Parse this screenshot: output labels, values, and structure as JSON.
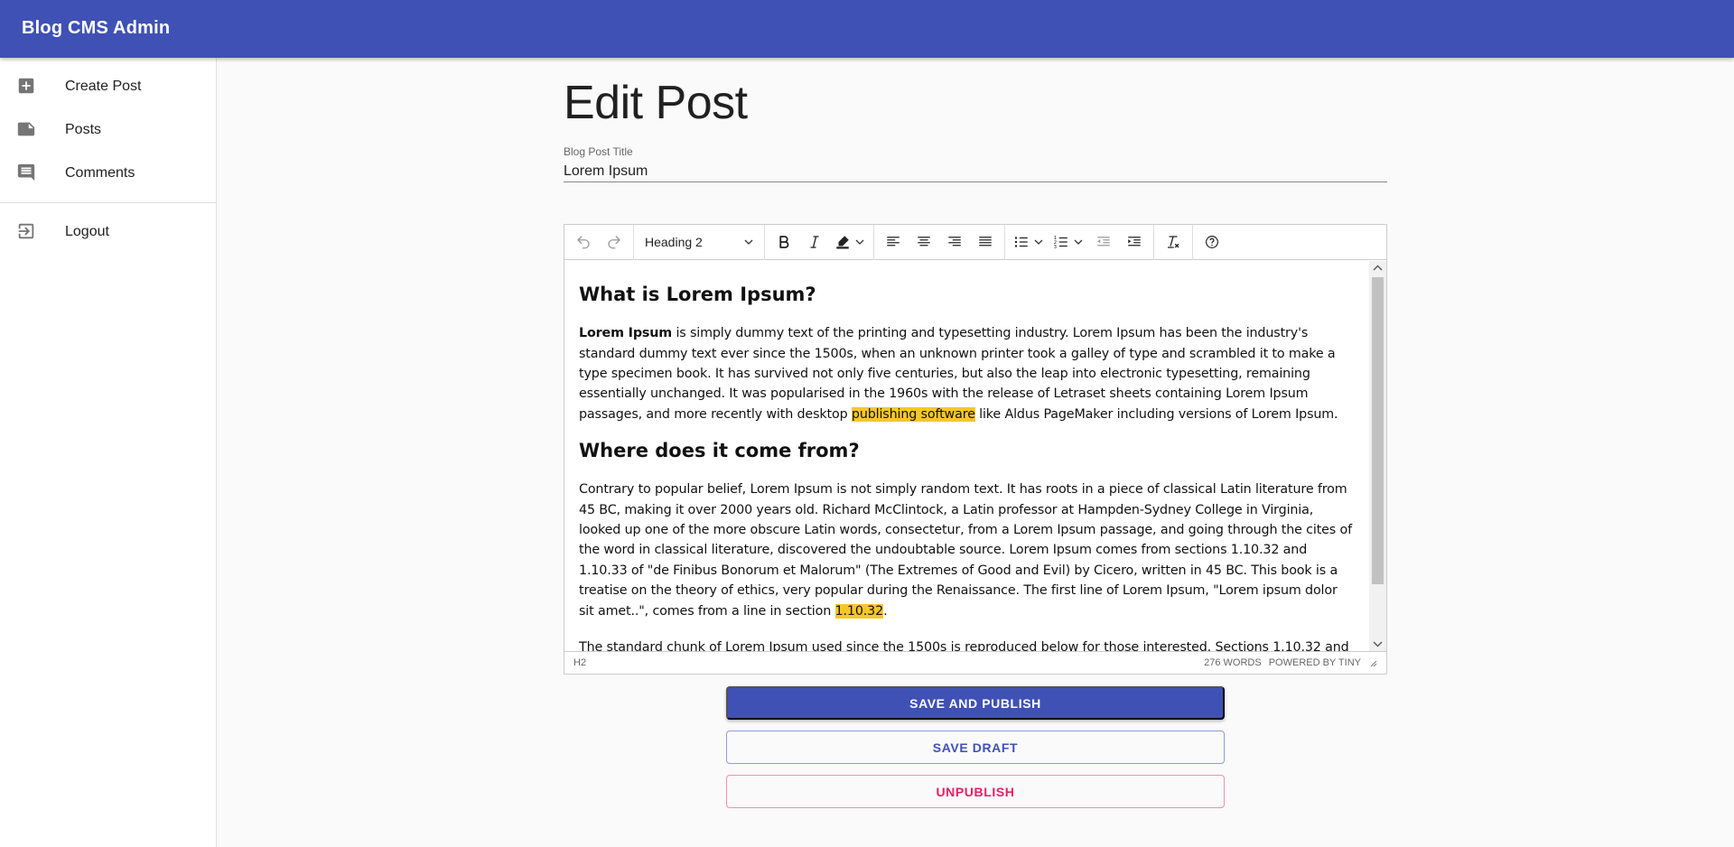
{
  "app": {
    "title": "Blog CMS Admin"
  },
  "nav": {
    "items": [
      {
        "label": "Create Post",
        "icon": "add-box-icon"
      },
      {
        "label": "Posts",
        "icon": "note-icon"
      },
      {
        "label": "Comments",
        "icon": "comment-icon"
      }
    ],
    "logout": {
      "label": "Logout",
      "icon": "logout-icon"
    }
  },
  "page": {
    "title": "Edit Post",
    "title_field": {
      "label": "Blog Post Title",
      "value": "Lorem Ipsum"
    }
  },
  "editor": {
    "toolbar": {
      "block_format": "Heading 2",
      "buttons": [
        "undo",
        "redo",
        "bold",
        "italic",
        "highlight-color",
        "align-left",
        "align-center",
        "align-right",
        "justify",
        "bullet-list",
        "numbered-list",
        "outdent",
        "indent",
        "clear-formatting",
        "help"
      ]
    },
    "content": {
      "h1": "What is Lorem Ipsum?",
      "p1": {
        "bold": "Lorem Ipsum",
        "text": " is simply dummy text of the printing and typesetting industry. Lorem Ipsum has been the industry's standard dummy text ever since the 1500s, when an unknown printer took a galley of type and scrambled it to make a type specimen book. It has survived not only five centuries, but also the leap into electronic typesetting, remaining essentially unchanged. It was popularised in the 1960s with the release of Letraset sheets containing Lorem Ipsum passages, and more recently with desktop ",
        "highlight": "publishing software",
        "tail": " like Aldus PageMaker including versions of Lorem Ipsum."
      },
      "h2": "Where does it come from?",
      "p2": {
        "text": "Contrary to popular belief, Lorem Ipsum is not simply random text. It has roots in a piece of classical Latin literature from 45 BC, making it over 2000 years old. Richard McClintock, a Latin professor at Hampden-Sydney College in Virginia, looked up one of the more obscure Latin words, consectetur, from a Lorem Ipsum passage, and going through the cites of the word in classical literature, discovered the undoubtable source. Lorem Ipsum comes from sections 1.10.32 and 1.10.33 of \"de Finibus Bonorum et Malorum\" (The Extremes of Good and Evil) by Cicero, written in 45 BC. This book is a treatise on the theory of ethics, very popular during the Renaissance. The first line of Lorem Ipsum, \"Lorem ipsum dolor sit amet..\", comes from a line in section ",
        "highlight": "1.10.32",
        "tail": "."
      },
      "p3": "The standard chunk of Lorem Ipsum used since the 1500s is reproduced below for those interested. Sections 1.10.32 and"
    },
    "status": {
      "path": "H2",
      "word_count": "276 WORDS",
      "powered_by": "POWERED BY TINY"
    }
  },
  "actions": {
    "save_publish": "SAVE AND PUBLISH",
    "save_draft": "SAVE DRAFT",
    "unpublish": "UNPUBLISH"
  },
  "colors": {
    "primary": "#3f51b5",
    "secondary": "#e91e63",
    "highlight": "#f7c62b"
  }
}
